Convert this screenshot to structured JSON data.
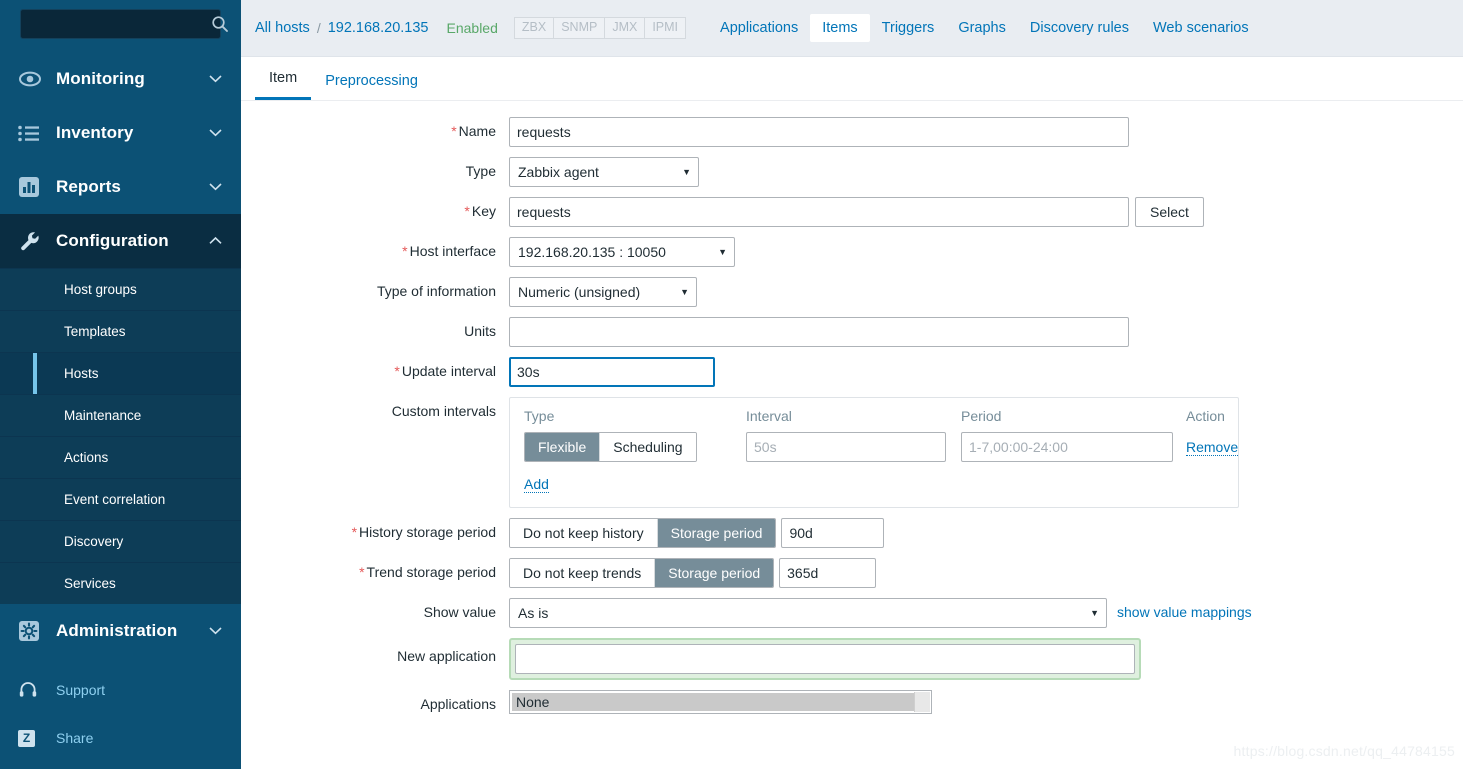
{
  "sidebar": {
    "search": {
      "value": "",
      "placeholder": "",
      "icon": "search-icon"
    },
    "menus": [
      {
        "label": "Monitoring",
        "icon": "eye-icon",
        "chevron": "⌄",
        "expanded": false
      },
      {
        "label": "Inventory",
        "icon": "list-icon",
        "chevron": "⌄",
        "expanded": false
      },
      {
        "label": "Reports",
        "icon": "bar-chart-icon",
        "chevron": "⌄",
        "expanded": false
      },
      {
        "label": "Configuration",
        "icon": "wrench-icon",
        "chevron": "⌃",
        "expanded": true
      },
      {
        "label": "Administration",
        "icon": "gear-icon",
        "chevron": "⌄",
        "expanded": false
      }
    ],
    "configuration_submenu": [
      {
        "label": "Host groups",
        "active": false
      },
      {
        "label": "Templates",
        "active": false
      },
      {
        "label": "Hosts",
        "active": true
      },
      {
        "label": "Maintenance",
        "active": false
      },
      {
        "label": "Actions",
        "active": false
      },
      {
        "label": "Event correlation",
        "active": false
      },
      {
        "label": "Discovery",
        "active": false
      },
      {
        "label": "Services",
        "active": false
      }
    ],
    "links": [
      {
        "label": "Support",
        "icon": "headset-icon"
      },
      {
        "label": "Share",
        "icon": "zabbix-logo-icon"
      }
    ]
  },
  "header": {
    "breadcrumb": {
      "root": "All hosts",
      "separator": "/",
      "current": "192.168.20.135"
    },
    "status": "Enabled",
    "availability": [
      "ZBX",
      "SNMP",
      "JMX",
      "IPMI"
    ],
    "tabs": [
      {
        "label": "Applications",
        "active": false
      },
      {
        "label": "Items",
        "active": true
      },
      {
        "label": "Triggers",
        "active": false
      },
      {
        "label": "Graphs",
        "active": false
      },
      {
        "label": "Discovery rules",
        "active": false
      },
      {
        "label": "Web scenarios",
        "active": false
      }
    ]
  },
  "form_tabs": [
    {
      "label": "Item",
      "active": true
    },
    {
      "label": "Preprocessing",
      "active": false
    }
  ],
  "form": {
    "name": {
      "label": "Name",
      "required": true,
      "value": "requests"
    },
    "type": {
      "label": "Type",
      "required": false,
      "value": "Zabbix agent",
      "caret": "▼"
    },
    "key": {
      "label": "Key",
      "required": true,
      "value": "requests",
      "button": "Select"
    },
    "host_interface": {
      "label": "Host interface",
      "required": true,
      "value": "192.168.20.135 : 10050",
      "caret": "▼"
    },
    "type_of_information": {
      "label": "Type of information",
      "required": false,
      "value": "Numeric (unsigned)",
      "caret": "▼"
    },
    "units": {
      "label": "Units",
      "required": false,
      "value": "",
      "placeholder": ""
    },
    "update_interval": {
      "label": "Update interval",
      "required": true,
      "value": "30s",
      "focused": true
    },
    "custom_intervals": {
      "label": "Custom intervals",
      "columns": [
        "Type",
        "Interval",
        "Period",
        "Action"
      ],
      "rows": [
        {
          "type_options": [
            {
              "label": "Flexible",
              "selected": true
            },
            {
              "label": "Scheduling",
              "selected": false
            }
          ],
          "interval_value": "",
          "interval_placeholder": "50s",
          "period_value": "",
          "period_placeholder": "1-7,00:00-24:00",
          "action": "Remove"
        }
      ],
      "add_label": "Add"
    },
    "history_storage_period": {
      "label": "History storage period",
      "required": true,
      "options": [
        {
          "label": "Do not keep history",
          "selected": false
        },
        {
          "label": "Storage period",
          "selected": true
        }
      ],
      "value": "90d"
    },
    "trend_storage_period": {
      "label": "Trend storage period",
      "required": true,
      "options": [
        {
          "label": "Do not keep trends",
          "selected": false
        },
        {
          "label": "Storage period",
          "selected": true
        }
      ],
      "value": "365d"
    },
    "show_value": {
      "label": "Show value",
      "required": false,
      "value": "As is",
      "caret": "▼",
      "link": "show value mappings"
    },
    "new_application": {
      "label": "New application",
      "required": false,
      "value": "",
      "placeholder": "",
      "highlighted": true
    },
    "applications": {
      "label": "Applications",
      "options": [
        {
          "label": "None",
          "selected": true
        }
      ]
    }
  },
  "watermark": "https://blog.csdn.net/qq_44784155",
  "colors": {
    "sidebar_bg": "#0c5175",
    "sidebar_submenu_bg": "#0d3d57",
    "sidebar_expanded_bg": "#0a2d42",
    "accent_blue": "#0275b8",
    "active_marker": "#76c5ea",
    "status_green": "#59a869",
    "required_red": "#e45959",
    "toggle_on": "#768d99",
    "header_bg": "#e9edf2",
    "highlight_green_border": "#b6dbb7",
    "highlight_green_bg": "#dff0df"
  }
}
